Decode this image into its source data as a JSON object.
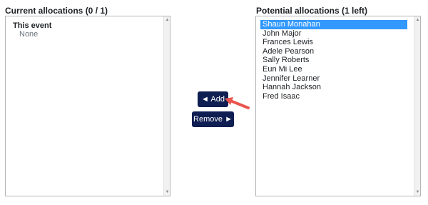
{
  "current": {
    "label": "Current allocations (0 / 1)",
    "group_label": "This event",
    "empty_text": "None"
  },
  "potential": {
    "label": "Potential allocations (1 left)",
    "options": [
      {
        "text": "Shaun Monahan",
        "selected": true
      },
      {
        "text": "John Major",
        "selected": false
      },
      {
        "text": "Frances Lewis",
        "selected": false
      },
      {
        "text": "Adele Pearson",
        "selected": false
      },
      {
        "text": "Sally Roberts",
        "selected": false
      },
      {
        "text": "Eun Mi Lee",
        "selected": false
      },
      {
        "text": "Jennifer Learner",
        "selected": false
      },
      {
        "text": "Hannah Jackson",
        "selected": false
      },
      {
        "text": "Fred Isaac",
        "selected": false
      }
    ]
  },
  "buttons": {
    "add_label": "◄ Add",
    "remove_label": "Remove ►"
  },
  "colors": {
    "button_bg": "#0f1e52",
    "selected_bg": "#3399ff",
    "annotation_arrow": "#e9554f"
  },
  "icons": {
    "annotation": "pointer-arrow-icon"
  }
}
